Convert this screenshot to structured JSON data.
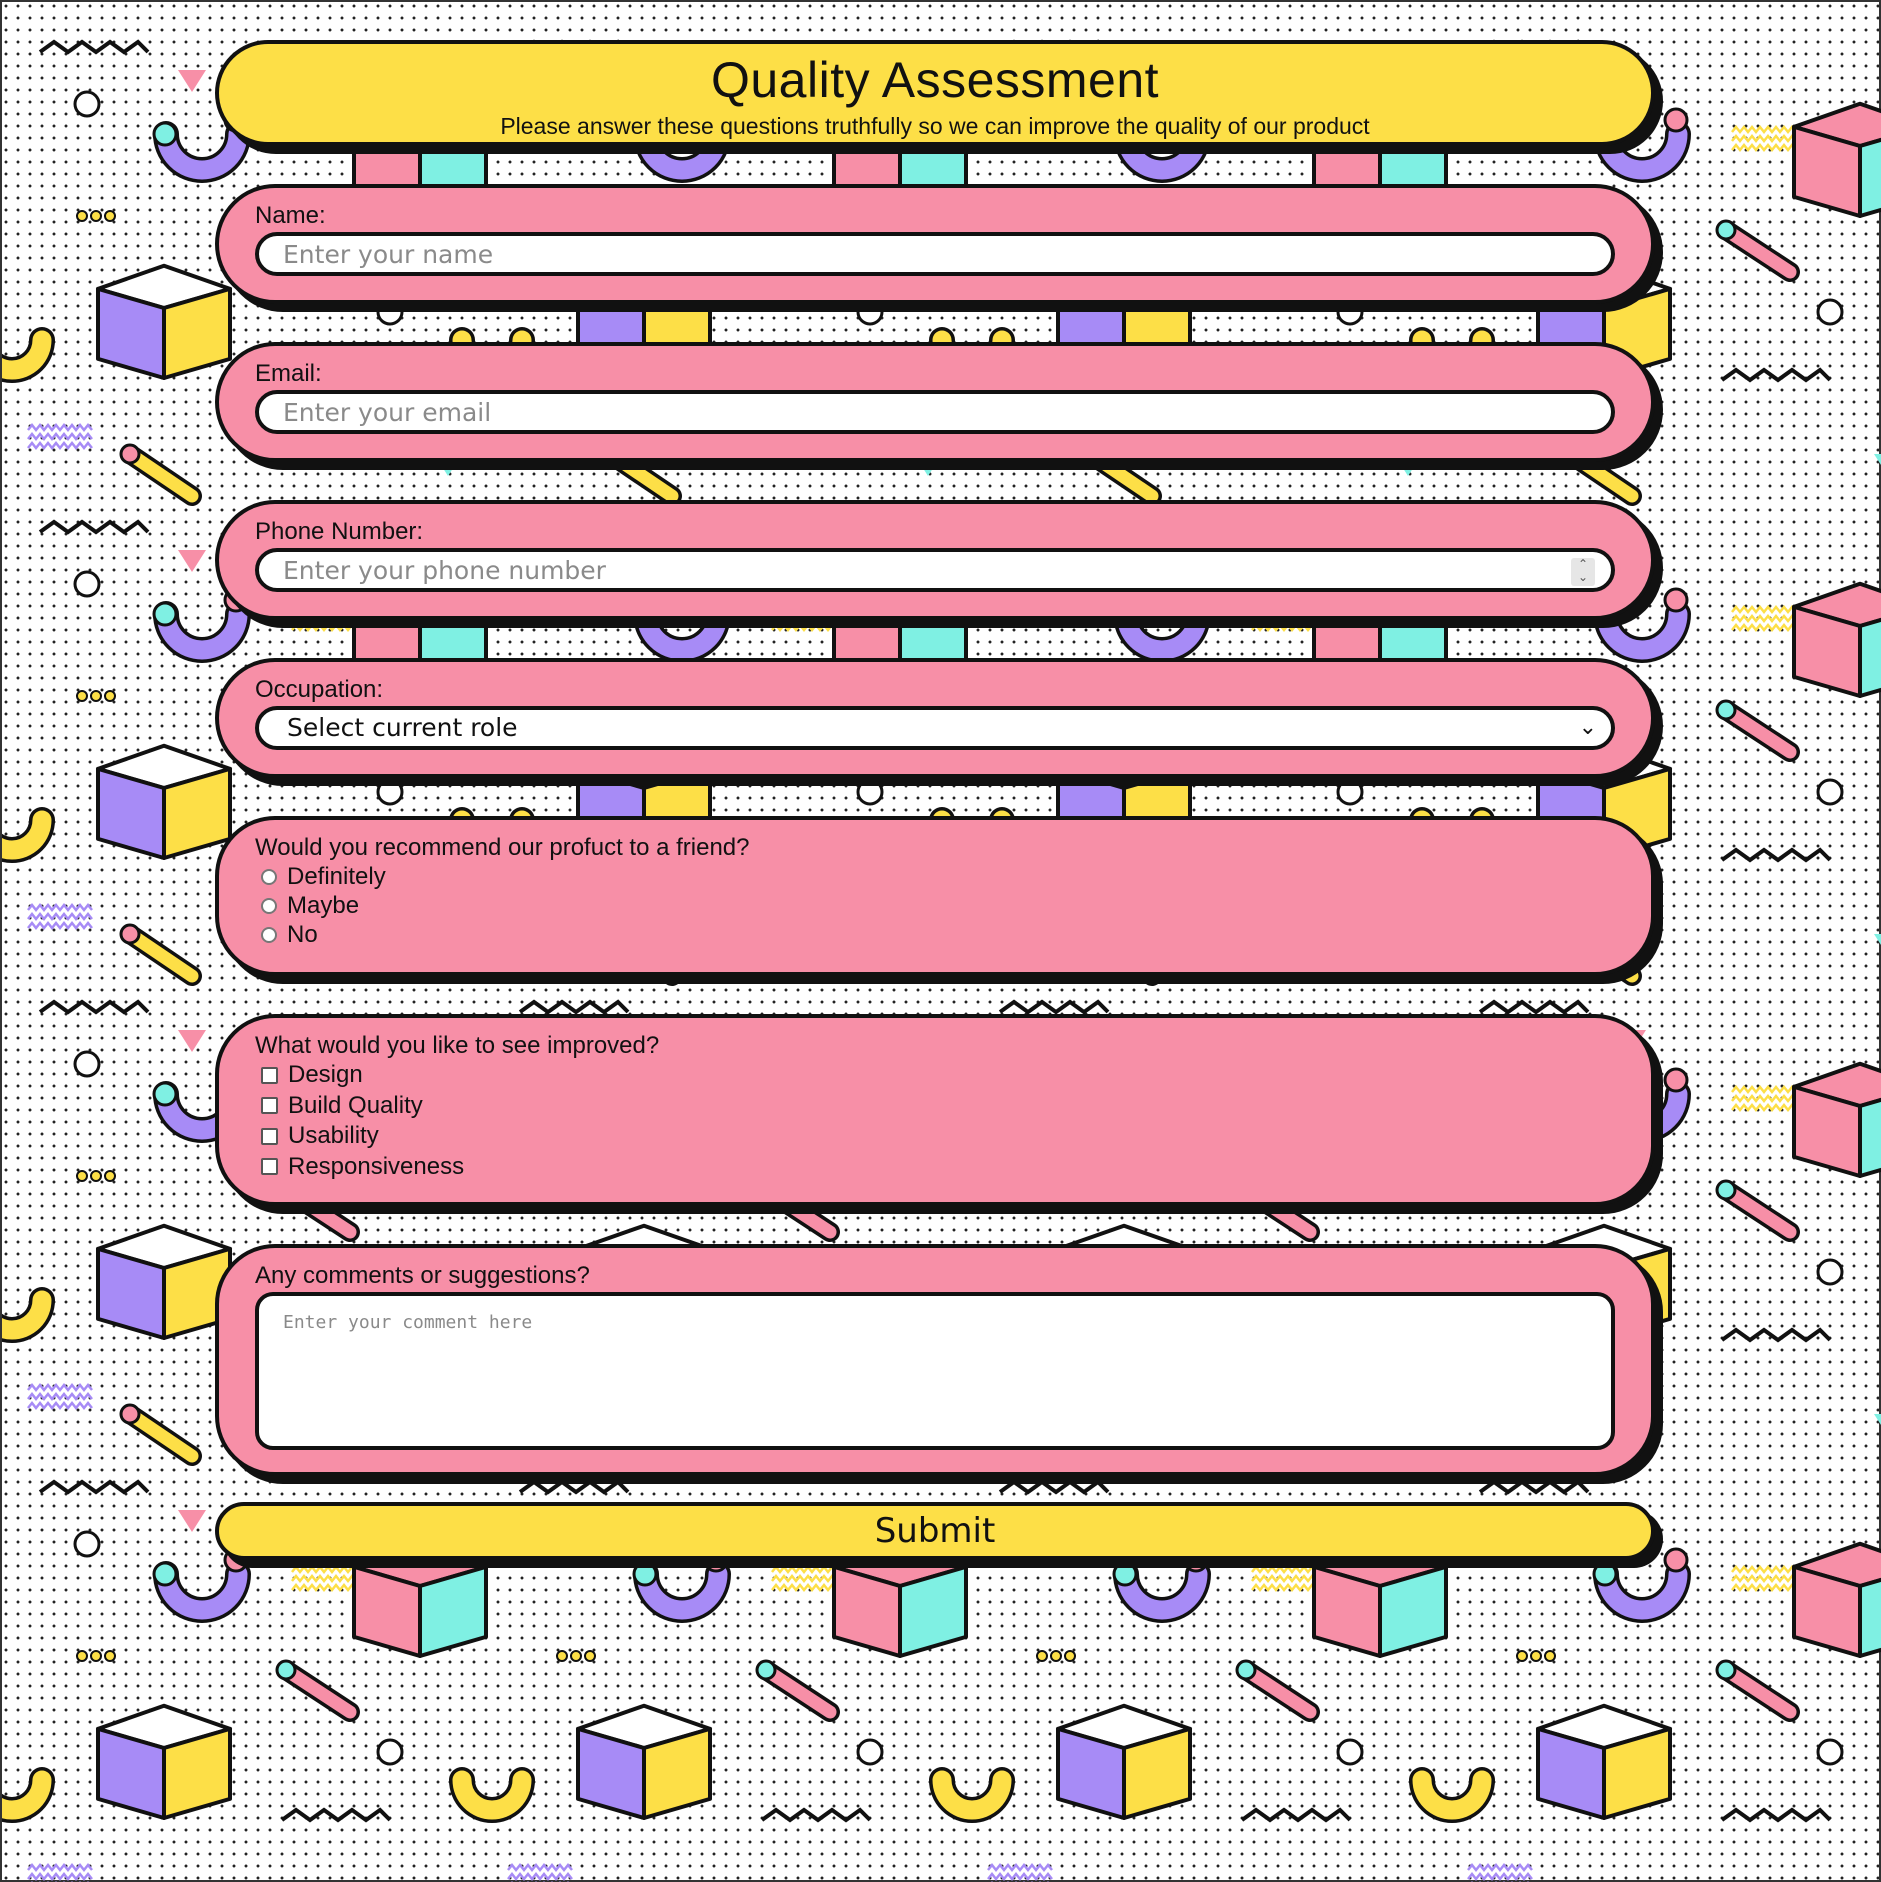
{
  "colors": {
    "form_accent": "#fddf47",
    "field_bg": "#f78fa7",
    "outline": "#111111",
    "pattern_purple": "#a78bf6",
    "pattern_teal": "#7ff0e3",
    "pattern_pink": "#f78fa7",
    "pattern_yellow": "#fddf47"
  },
  "header": {
    "title": "Quality Assessment",
    "subtitle": "Please answer these questions truthfully so we can improve the quality of our product"
  },
  "fields": {
    "name": {
      "label": "Name:",
      "placeholder": "Enter your name",
      "value": ""
    },
    "email": {
      "label": "Email:",
      "placeholder": "Enter your email",
      "value": ""
    },
    "phone": {
      "label": "Phone Number:",
      "placeholder": "Enter your phone number",
      "value": ""
    },
    "occupation": {
      "label": "Occupation:",
      "selected": "Select current role"
    }
  },
  "recommend": {
    "question": "Would you recommend our profuct to a friend?",
    "options": [
      "Definitely",
      "Maybe",
      "No"
    ]
  },
  "improve": {
    "question": "What would you like to see improved?",
    "options": [
      "Design",
      "Build Quality",
      "Usability",
      "Responsiveness"
    ]
  },
  "comments": {
    "label": "Any comments or suggestions?",
    "placeholder": "Enter your comment here"
  },
  "submit_label": "Submit"
}
